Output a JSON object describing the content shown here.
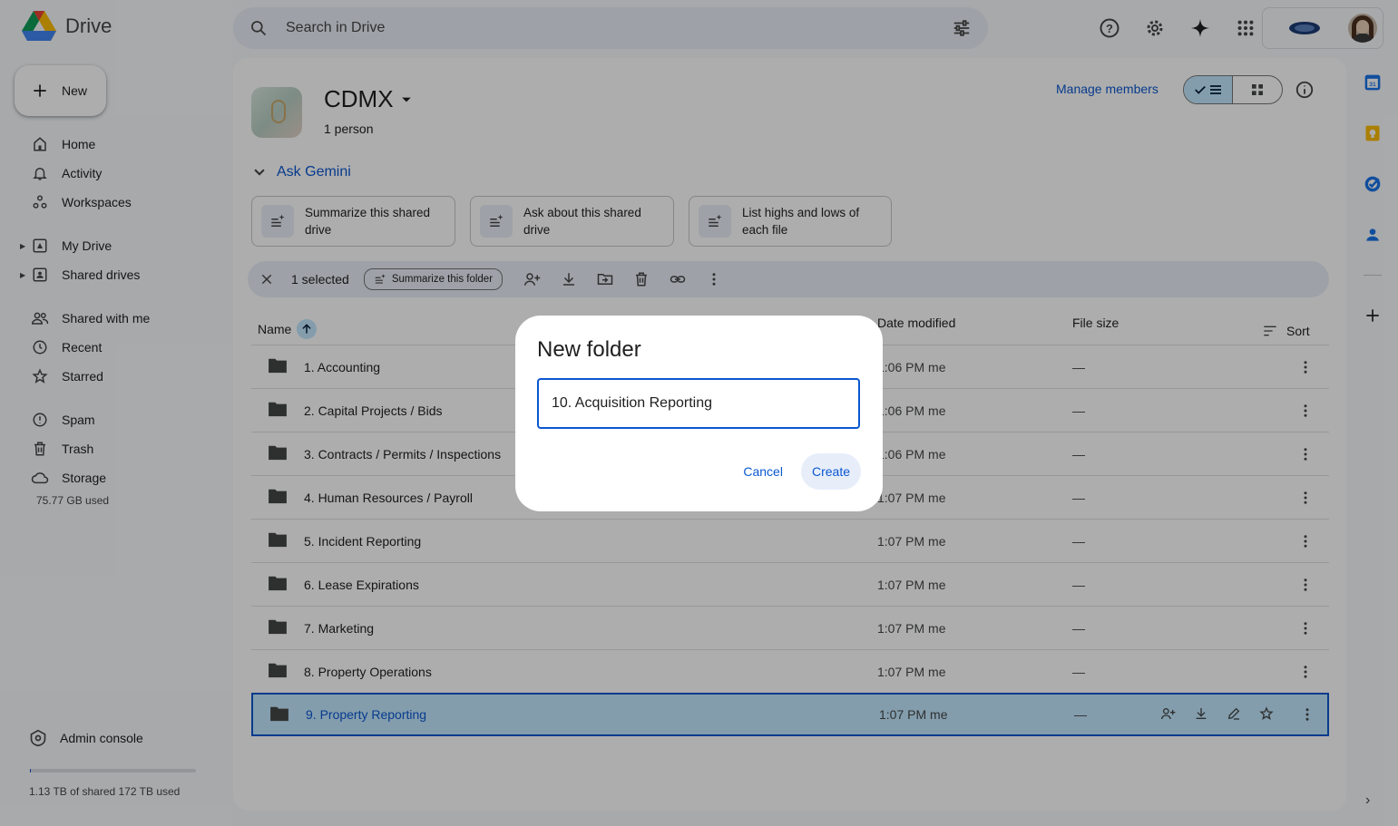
{
  "app": {
    "logo_text": "Drive"
  },
  "search": {
    "placeholder": "Search in Drive"
  },
  "new_button": {
    "label": "New"
  },
  "nav": {
    "items": [
      {
        "label": "Home",
        "icon": "home-icon"
      },
      {
        "label": "Activity",
        "icon": "bell-icon"
      },
      {
        "label": "Workspaces",
        "icon": "workspaces-icon"
      },
      {
        "label": "My Drive",
        "icon": "my-drive-icon"
      },
      {
        "label": "Shared drives",
        "icon": "shared-drives-icon"
      },
      {
        "label": "Shared with me",
        "icon": "people-icon"
      },
      {
        "label": "Recent",
        "icon": "clock-icon"
      },
      {
        "label": "Starred",
        "icon": "star-icon"
      },
      {
        "label": "Spam",
        "icon": "spam-icon"
      },
      {
        "label": "Trash",
        "icon": "trash-icon"
      },
      {
        "label": "Storage",
        "icon": "cloud-icon"
      }
    ],
    "storage_used": "75.77 GB used",
    "admin_console": "Admin console",
    "shared_storage": "1.13 TB of shared 172 TB used",
    "shared_storage_fraction": 0.0066
  },
  "drive": {
    "name": "CDMX",
    "members": "1 person",
    "manage_members": "Manage members"
  },
  "gemini": {
    "title": "Ask Gemini",
    "chips": [
      {
        "line1": "Summarize this shared",
        "line2": "drive"
      },
      {
        "line1": "Ask about this shared",
        "line2": "drive"
      },
      {
        "line1": "List highs and lows of",
        "line2": "each file"
      }
    ]
  },
  "selection": {
    "count_label": "1 selected",
    "summarize_label": "Summarize this folder"
  },
  "table": {
    "headers": {
      "name": "Name",
      "date": "Date modified",
      "size": "File size",
      "sort": "Sort"
    },
    "rows": [
      {
        "name": "1. Accounting",
        "date": "1:06 PM me",
        "size": "—"
      },
      {
        "name": "2. Capital Projects / Bids",
        "date": "1:06 PM me",
        "size": "—"
      },
      {
        "name": "3. Contracts / Permits / Inspections",
        "date": "1:06 PM me",
        "size": "—"
      },
      {
        "name": "4. Human Resources / Payroll",
        "date": "1:07 PM me",
        "size": "—"
      },
      {
        "name": "5. Incident Reporting",
        "date": "1:07 PM me",
        "size": "—"
      },
      {
        "name": "6. Lease Expirations",
        "date": "1:07 PM me",
        "size": "—"
      },
      {
        "name": "7. Marketing",
        "date": "1:07 PM me",
        "size": "—"
      },
      {
        "name": "8. Property Operations",
        "date": "1:07 PM me",
        "size": "—"
      },
      {
        "name": "9. Property Reporting",
        "date": "1:07 PM me",
        "size": "—"
      }
    ]
  },
  "dialog": {
    "title": "New folder",
    "input_value": "10. Acquisition Reporting",
    "cancel": "Cancel",
    "create": "Create"
  },
  "colors": {
    "accent": "#0b57d0",
    "selected_row": "#c2e7ff"
  }
}
